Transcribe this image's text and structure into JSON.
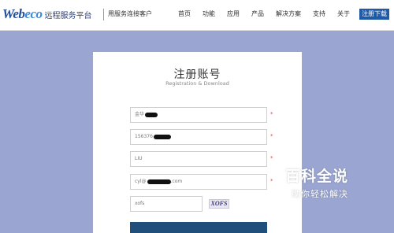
{
  "brand": {
    "logo_main": "Web",
    "logo_sub": "eco",
    "logo_cn": "远程服务平台",
    "tagline": "用服务连接客户"
  },
  "nav": {
    "items": [
      "首页",
      "功能",
      "应用",
      "产品",
      "解决方案",
      "支持",
      "关于"
    ],
    "cta": "注册下载"
  },
  "form": {
    "title": "注册账号",
    "subtitle": "Registration & Download",
    "fields": {
      "company": "金华",
      "phone": "156376",
      "name": "LIU",
      "email_prefix": "cyl@",
      "email_suffix": ".com",
      "captcha_input": "xofs"
    },
    "required_mark": "*",
    "captcha_text": "XOFS"
  },
  "watermark": {
    "main": "百科全说",
    "sub": "助你轻松解决"
  },
  "colors": {
    "background": "#9aa5d1",
    "brand": "#1f5aa6",
    "required": "#e04848"
  }
}
